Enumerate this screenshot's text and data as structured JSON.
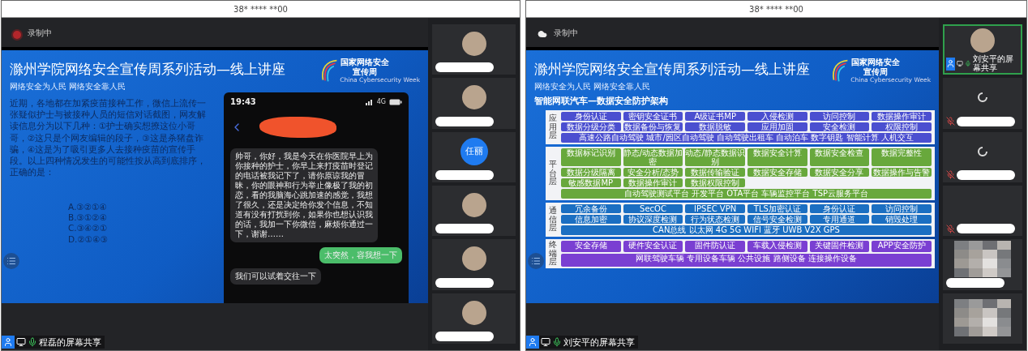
{
  "screens": [
    {
      "title": "38* **** **00",
      "recording": {
        "label": "录制中"
      },
      "slide": {
        "kind": "quiz",
        "title": "滁州学院网络安全宣传周系列活动—线上讲座",
        "subtitle": "网络安全为人民 网络安全靠人民",
        "logo": {
          "title": "国家网络安全宣传周",
          "caption": "China Cybersecurity Week"
        },
        "question": "近期，各地都在加紧疫苗接种工作，微信上流传一张疑似护士与被接种人员的短信对话截图，网友解读信息分为以下几种：①护士确实想撩这位小哥哥，②这只是个网友编辑的段子，③这是杀猪盘诈骗，④这是为了吸引更多人去接种疫苗的宣传手段。以上四种情况发生的可能性按从高到底排序，正确的是：",
        "options": [
          "A.③②①④",
          "B.③①②④",
          "C.③④②①",
          "D.②①④③"
        ],
        "phone": {
          "time": "19:43",
          "network": "4G",
          "messages": [
            {
              "kind": "incoming",
              "text": "帅哥，你好，我是今天在你医院早上为你接种的护士，你早上来打疫苗时登记的电话被我记下了，请你原谅我的冒昧，你的眼神和行为举止像极了我的初恋，看的我脑海心跳加速的感觉，我想了很久，还是决定给你发个信息，不知道有没有打扰到你，如果你也想认识我的话，我加一下你微信，麻烦你通过一下，谢谢……"
            },
            {
              "kind": "outgoing",
              "text": "太突然，容我想一下"
            },
            {
              "kind": "incoming",
              "text": "我们可以试着交往一下"
            }
          ]
        }
      },
      "participants": [
        {
          "kind": "avatar",
          "active": false,
          "name_hidden": true
        },
        {
          "kind": "avatar",
          "active": false,
          "name_hidden": true
        },
        {
          "kind": "initials",
          "initials": "任丽",
          "active": false,
          "name_hidden": true
        },
        {
          "kind": "avatar",
          "active": false,
          "name_hidden": true
        },
        {
          "kind": "avatar",
          "active": false,
          "name_hidden": true
        },
        {
          "kind": "avatar",
          "active": false,
          "name_hidden": true
        }
      ],
      "share": {
        "label": "程磊的屏幕共享"
      }
    },
    {
      "title": "38* **** **00",
      "recording": {
        "label": "录制中"
      },
      "slide": {
        "kind": "diagram",
        "title": "滁州学院网络安全宣传周系列活动—线上讲座",
        "subtitle": "网络安全为人民 网络安全靠人民",
        "heading": "智能网联汽车—数据安全防护架构",
        "logo": {
          "title": "国家网络安全宣传周",
          "caption": "China Cybersecurity Week"
        },
        "layers": [
          {
            "label": "应用层",
            "color": "#4b4fd0",
            "items": [
              "身份认证",
              "密钥安全证书",
              "A级证书MP",
              "入侵检测",
              "访问控制",
              "数据操作审计",
              "数据分级分类",
              "数据备份与恢复",
              "数据脱敏",
              "应用加固",
              "安全检测",
              "权限控制"
            ],
            "bar": "高速公路自动驾驶 城市/园区自动驾驶 自动驾驶出租车 自动泊车 数字钥匙 智能计算 人机交互"
          },
          {
            "label": "平台层",
            "color": "#68a83c",
            "items": [
              "数据标记识别",
              "静态/动态数据加密",
              "动态/静态数据识别",
              "数据安全计算",
              "数据安全检查",
              "数据完整性",
              "数据分级隔离",
              "安全分析/态势",
              "数据传输验证",
              "数据安全存储",
              "数据安全分享",
              "数据操作与告警",
              "敏感数据MP",
              "数据操作审计",
              "数据权限控制"
            ],
            "bar": "自动驾驶测试平台 开发平台 OTA平台 车辆监控平台 TSP云服务平台"
          },
          {
            "label": "通信层",
            "color": "#1b6fc2",
            "items": [
              "冗余备份",
              "SecOC",
              "IPSEC VPN",
              "TLS加密认证",
              "身份认证",
              "访问控制",
              "信息加密",
              "协议深度检测",
              "行为状态检测",
              "信号安全检测",
              "专用通道",
              "销毁处理"
            ],
            "bar": "CAN总线 以太网 4G 5G WIFI 蓝牙 UWB V2X GPS"
          },
          {
            "label": "终端层",
            "color": "#7a3fd2",
            "items": [
              "安全存储",
              "硬件安全认证",
              "固件防认证",
              "车载入侵检测",
              "关键固件检测",
              "APP安全防护"
            ],
            "bar": "网联驾驶车辆 专用设备车辆 公共设施 路侧设备 连接操作设备"
          }
        ]
      },
      "participants": [
        {
          "kind": "avatar",
          "active": true,
          "muted": false,
          "label": "刘安平的屏幕共享",
          "name_hidden": false
        },
        {
          "kind": "loading",
          "active": false,
          "muted": true,
          "name_hidden": true
        },
        {
          "kind": "loading",
          "active": false,
          "muted": true,
          "name_hidden": true
        },
        {
          "kind": "empty",
          "active": false,
          "muted": true,
          "name_hidden": true
        },
        {
          "kind": "pixelated",
          "active": false,
          "name_hidden": true
        },
        {
          "kind": "pixelated",
          "active": false,
          "name_hidden": false
        }
      ],
      "share": {
        "label": "刘安平的屏幕共享"
      }
    }
  ]
}
